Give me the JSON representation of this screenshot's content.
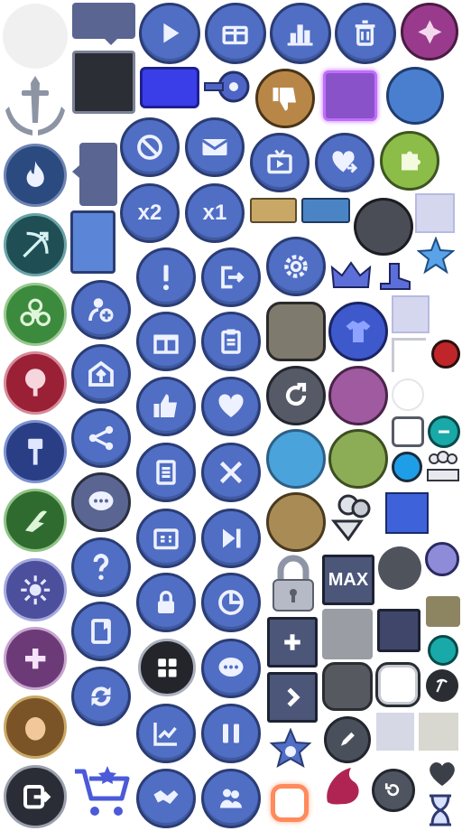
{
  "sheet": {
    "background": "#ffffff"
  },
  "labels": {
    "x2": "x2",
    "x1": "x1",
    "max": "MAX"
  },
  "colors": {
    "button_blue": "#4f6ec4",
    "button_border": "#2b3c74",
    "slate": "#5a6591",
    "gold": "#c9a867",
    "purple_gem": "#8a3fb8",
    "teal": "#19a9a9",
    "red_dot": "#c0252a"
  },
  "icons": [
    "play-icon",
    "gift-box-icon",
    "bar-chart-icon",
    "trash-icon",
    "emblem-icon",
    "thumbs-down-icon",
    "prohibited-icon",
    "mail-icon",
    "tv-icon",
    "heart-share-icon",
    "puzzle-icon",
    "exclamation-icon",
    "logout-icon",
    "settings-gear-icon",
    "crown-icon",
    "boot-icon",
    "star-badge-icon",
    "add-user-icon",
    "gift-icon",
    "clipboard-icon",
    "shirt-icon",
    "invite-icon",
    "thumbs-up-icon",
    "heart-icon",
    "refresh-icon",
    "share-icon",
    "list-icon",
    "crossed-swords-icon",
    "chat-icon",
    "id-card-icon",
    "skip-forward-icon",
    "question-icon",
    "lock-icon",
    "pie-chart-icon",
    "padlock-icon",
    "users-icon",
    "book-icon",
    "grid-icon",
    "speech-bubble-icon",
    "plus-icon",
    "swap-icon",
    "line-chart-icon",
    "pause-icon",
    "chevron-right-icon",
    "pencil-icon",
    "cart-icon",
    "handshake-icon",
    "group-icon",
    "sheriff-badge-icon",
    "restart-icon",
    "hourglass-icon",
    "sword-emblem-icon",
    "fire-icon",
    "bow-icon",
    "biohazard-icon",
    "tree-icon",
    "hammer-icon",
    "claw-icon",
    "sun-icon",
    "medic-icon",
    "head-icon",
    "exit-icon",
    "minus-icon",
    "pickaxe-icon",
    "ad-icon",
    "heart-dark-icon",
    "user-team-icon"
  ]
}
